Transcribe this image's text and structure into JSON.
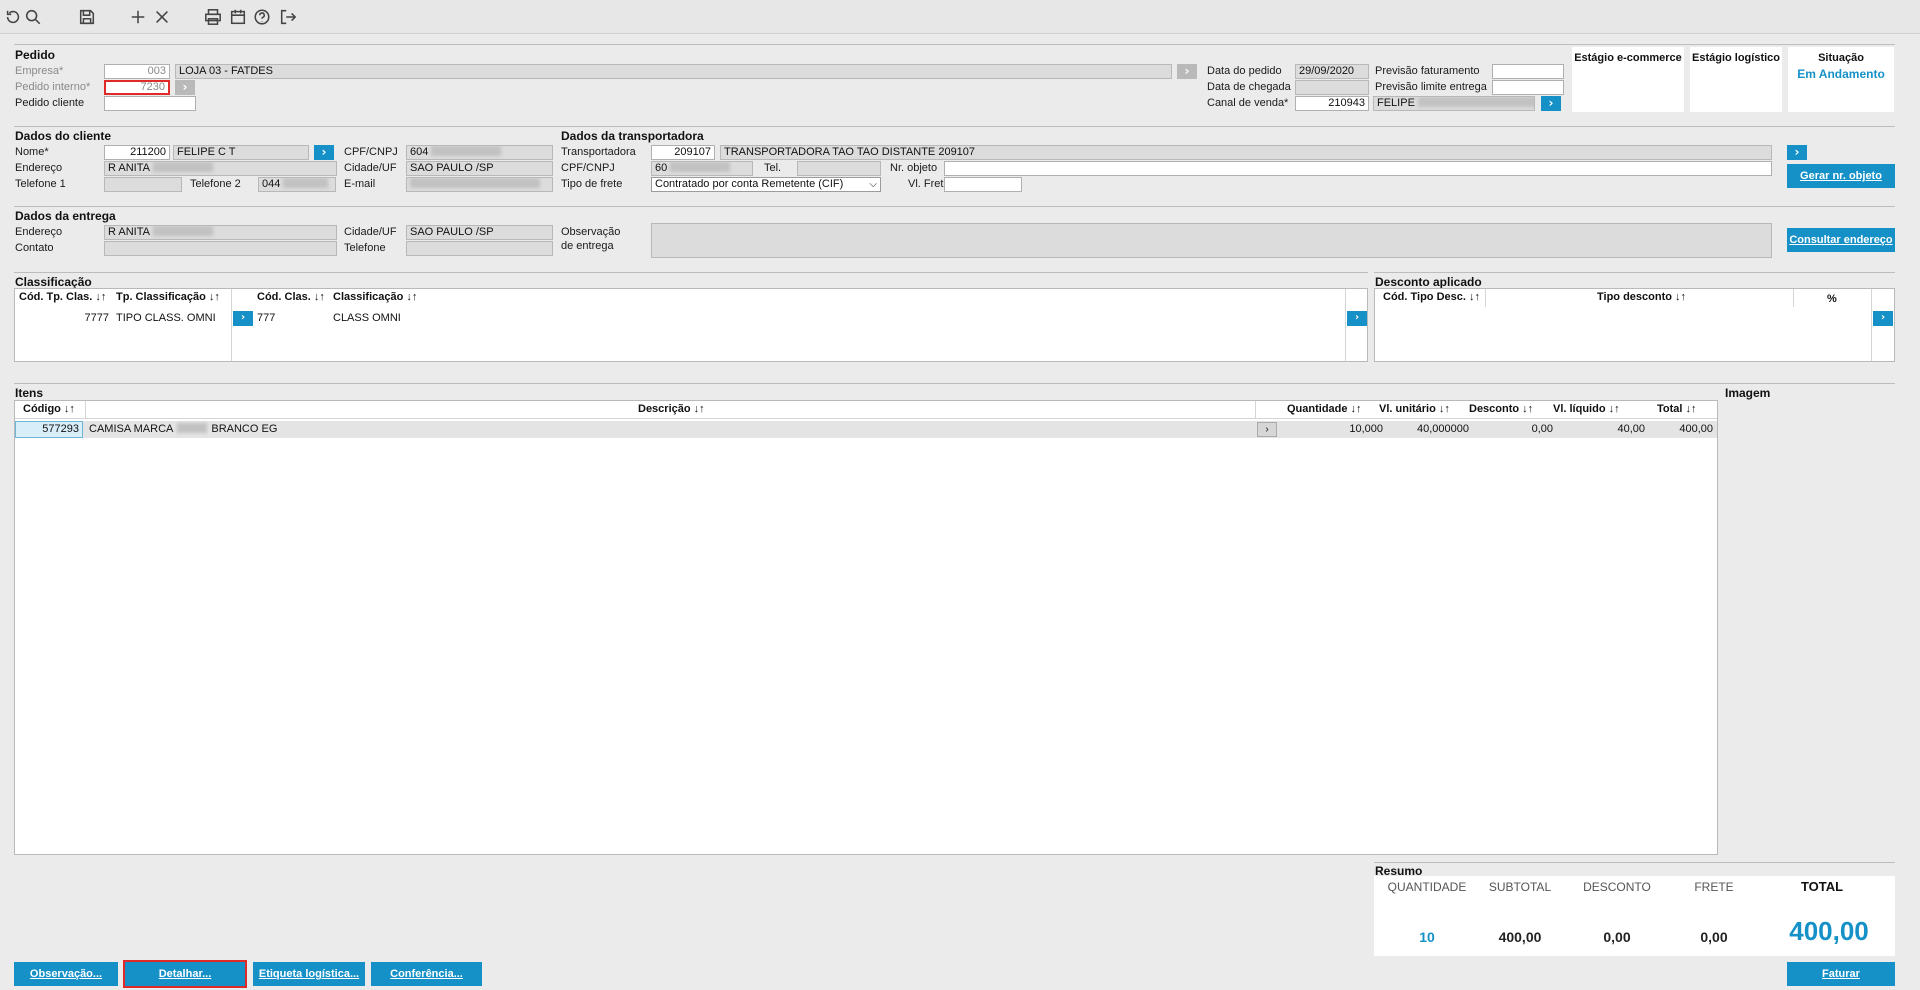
{
  "toolbar": {
    "icons": [
      "refresh-icon",
      "search-icon",
      "save-icon",
      "add-icon",
      "close-icon",
      "print-icon",
      "calendar-icon",
      "help-icon",
      "exit-icon"
    ]
  },
  "pedido": {
    "title": "Pedido",
    "empresa_label": "Empresa*",
    "empresa_code": "003",
    "empresa_name": "LOJA 03 - FATDES",
    "interno_label": "Pedido interno*",
    "interno_value": "7230",
    "cliente_label": "Pedido cliente",
    "cliente_value": "",
    "data_pedido_label": "Data do pedido",
    "data_pedido_value": "29/09/2020",
    "data_chegada_label": "Data de chegada",
    "data_chegada_value": "",
    "canal_label": "Canal de venda*",
    "canal_code": "210943",
    "canal_name": "FELIPE",
    "prev_fat_label": "Previsão faturamento",
    "prev_fat_value": "",
    "prev_lim_label": "Previsão limite entrega",
    "prev_lim_value": "",
    "stage_ecommerce": "Estágio e-commerce",
    "stage_logistico": "Estágio logístico",
    "situacao_label": "Situação",
    "situacao_value": "Em Andamento"
  },
  "cliente": {
    "title": "Dados do cliente",
    "nome_label": "Nome*",
    "nome_code": "211200",
    "nome_value": "FELIPE C T",
    "endereco_label": "Endereço",
    "endereco_value": "R ANITA",
    "tel1_label": "Telefone 1",
    "tel2_label": "Telefone 2",
    "tel2_value": "044",
    "cpf_label": "CPF/CNPJ",
    "cpf_value": "604",
    "cidade_label": "Cidade/UF",
    "cidade_value": "SAO PAULO /SP",
    "email_label": "E-mail"
  },
  "transportadora": {
    "title": "Dados da transportadora",
    "transp_label": "Transportadora",
    "transp_code": "209107",
    "transp_name": "TRANSPORTADORA TAO TAO DISTANTE   209107",
    "cpf_label": "CPF/CNPJ",
    "cpf_value": "60",
    "tel_label": "Tel.",
    "nr_objeto_label": "Nr. objeto",
    "frete_tipo_label": "Tipo de frete",
    "frete_tipo_value": "Contratado por conta Remetente (CIF)",
    "vl_frete_label": "Vl. Frete",
    "gerar_button": "Gerar nr. objeto"
  },
  "entrega": {
    "title": "Dados da entrega",
    "endereco_label": "Endereço",
    "endereco_value": "R ANITA",
    "contato_label": "Contato",
    "cidade_label": "Cidade/UF",
    "cidade_value": "SAO PAULO /SP",
    "telefone_label": "Telefone",
    "obs_label1": "Observação",
    "obs_label2": "de entrega",
    "consultar_button": "Consultar endereço"
  },
  "classificacao": {
    "title": "Classificação",
    "headers": [
      "Cód. Tp. Clas. ↓↑",
      "Tp. Classificação ↓↑",
      "Cód. Clas. ↓↑",
      "Classificação ↓↑"
    ],
    "row": {
      "cod_tp": "7777",
      "tp": "TIPO CLASS. OMNI",
      "cod": "777",
      "clas": "CLASS OMNI"
    }
  },
  "desconto": {
    "title": "Desconto aplicado",
    "headers": [
      "Cód. Tipo Desc. ↓↑",
      "Tipo desconto ↓↑",
      "%"
    ]
  },
  "itens": {
    "title": "Itens",
    "imagem_label": "Imagem",
    "headers": {
      "codigo": "Código ↓↑",
      "descricao": "Descrição ↓↑",
      "quantidade": "Quantidade ↓↑",
      "vl_unitario": "Vl. unitário ↓↑",
      "desconto": "Desconto ↓↑",
      "vl_liquido": "Vl. líquido ↓↑",
      "total": "Total ↓↑"
    },
    "rows": [
      {
        "codigo": "577293",
        "descricao_a": "CAMISA MARCA",
        "descricao_b": "BRANCO EG",
        "quantidade": "10,000",
        "vl_unitario": "40,000000",
        "desconto": "0,00",
        "vl_liquido": "40,00",
        "total": "400,00"
      }
    ]
  },
  "resumo": {
    "title": "Resumo",
    "quantidade_label": "QUANTIDADE",
    "subtotal_label": "SUBTOTAL",
    "desconto_label": "DESCONTO",
    "frete_label": "FRETE",
    "total_label": "TOTAL",
    "quantidade": "10",
    "subtotal": "400,00",
    "desconto": "0,00",
    "frete": "0,00",
    "total": "400,00"
  },
  "footer": {
    "observacao": "Observação...",
    "detalhar": "Detalhar...",
    "etiqueta": "Etiqueta logística...",
    "conferencia": "Conferência...",
    "faturar": "Faturar"
  },
  "colors": {
    "accent": "#1591c8",
    "highlight": "#e02a2a"
  }
}
